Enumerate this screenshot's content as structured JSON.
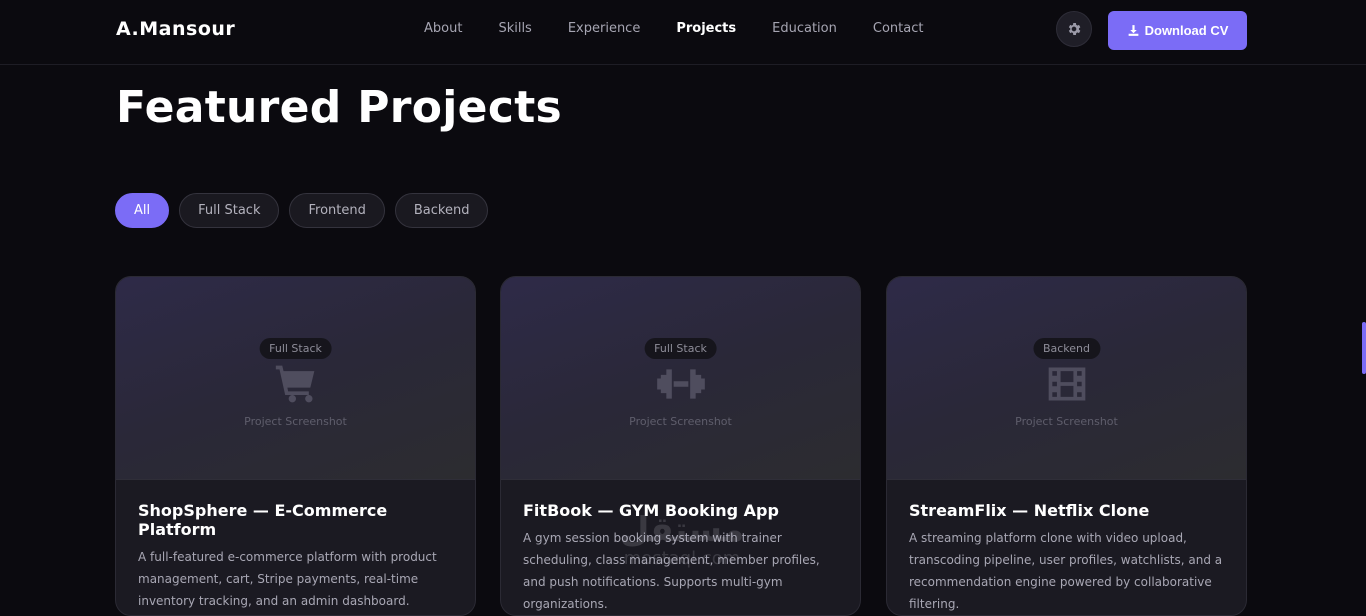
{
  "nav": {
    "logo": "A.Mansour",
    "links": [
      "About",
      "Skills",
      "Experience",
      "Projects",
      "Education",
      "Contact"
    ],
    "active": "Projects",
    "theme_icon": "gear-icon",
    "cv_button": "Download CV",
    "cv_icon": "download-icon"
  },
  "section": {
    "title": "Featured Projects"
  },
  "filters": [
    "All",
    "Full Stack",
    "Frontend",
    "Backend"
  ],
  "active_filter": "All",
  "projects": [
    {
      "tag": "Full Stack",
      "icon": "shopping-cart-icon",
      "caption": "Project Screenshot",
      "title": "ShopSphere — E-Commerce Platform",
      "description": "A full-featured e-commerce platform with product management, cart, Stripe payments, real-time inventory tracking, and an admin dashboard."
    },
    {
      "tag": "Full Stack",
      "icon": "dumbbell-icon",
      "caption": "Project Screenshot",
      "title": "FitBook — GYM Booking App",
      "description": "A gym session booking system with trainer scheduling, class management, member profiles, and push notifications. Supports multi-gym organizations."
    },
    {
      "tag": "Backend",
      "icon": "film-icon",
      "caption": "Project Screenshot",
      "title": "StreamFlix — Netflix Clone",
      "description": "A streaming platform clone with video upload, transcoding pipeline, user profiles, watchlists, and a recommendation engine powered by collaborative filtering."
    }
  ],
  "watermark": {
    "arabic": "مستقل",
    "latin": "mostaql.com"
  },
  "colors": {
    "accent": "#7b6cf6",
    "background": "#0b0a0f",
    "card": "#1b1a22"
  }
}
